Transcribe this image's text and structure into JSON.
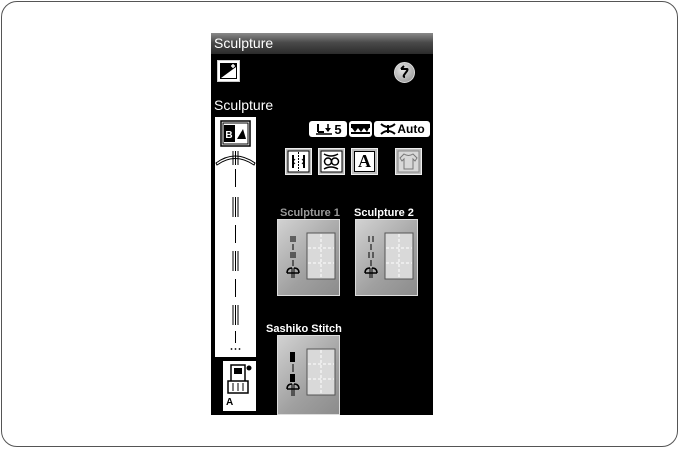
{
  "screen": {
    "title": "Sculpture",
    "section_label": "Sculpture",
    "foot_letter": "A",
    "presser_foot_height": "5",
    "auto_label": "Auto",
    "text_icon_letter": "A"
  },
  "patterns": [
    {
      "label": "Sculpture 1",
      "selected": false
    },
    {
      "label": "Sculpture 2",
      "selected": true
    },
    {
      "label": "Sashiko Stitch",
      "selected": true
    }
  ],
  "colors": {
    "screen_bg": "#000000",
    "inactive_label": "#9a9a9a",
    "active_label": "#ffffff"
  }
}
